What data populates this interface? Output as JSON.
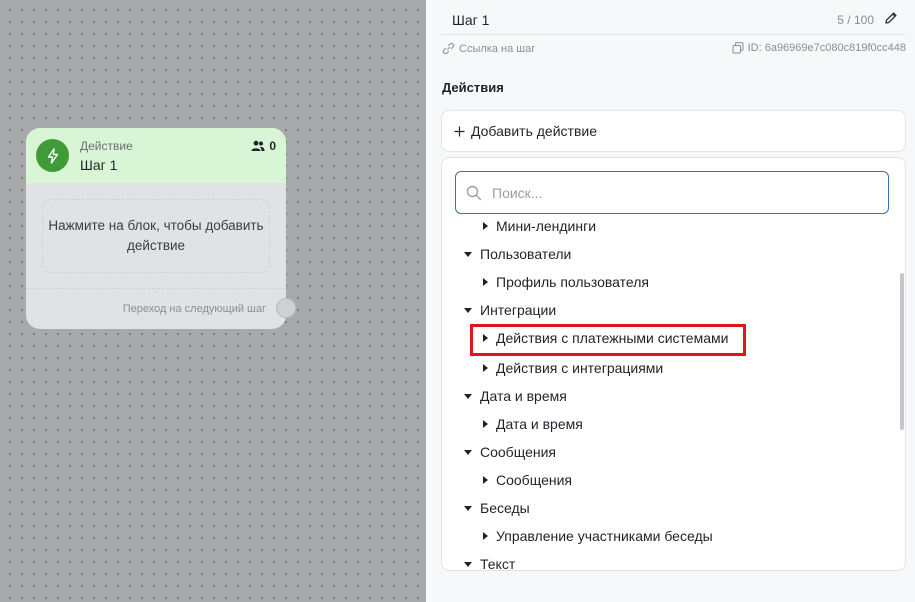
{
  "canvas": {
    "node": {
      "type_label": "Действие",
      "title": "Шаг 1",
      "users_count": "0",
      "body_text": "Нажмите на блок, чтобы добавить действие",
      "next_label": "Переход на следующий шаг",
      "icon": "lightning-icon",
      "accent": "#3e9b35"
    }
  },
  "panel": {
    "step_name": "Шаг 1",
    "step_count": "5 / 100",
    "link_label": "Ссылка на шаг",
    "step_id": "ID: 6a96969e7c080c819f0cc448",
    "section_title": "Действия",
    "add_action_label": "Добавить действие",
    "search_placeholder": "Поиск...",
    "tree": [
      {
        "label": "Мини-лендинги",
        "level": 1,
        "expanded": false
      },
      {
        "label": "Пользователи",
        "level": 0,
        "expanded": true
      },
      {
        "label": "Профиль пользователя",
        "level": 1,
        "expanded": false
      },
      {
        "label": "Интеграции",
        "level": 0,
        "expanded": true
      },
      {
        "label": "Действия с платежными системами",
        "level": 1,
        "expanded": false,
        "highlighted": true
      },
      {
        "label": "Действия с интеграциями",
        "level": 1,
        "expanded": false
      },
      {
        "label": "Дата и время",
        "level": 0,
        "expanded": true
      },
      {
        "label": "Дата и время",
        "level": 1,
        "expanded": false
      },
      {
        "label": "Сообщения",
        "level": 0,
        "expanded": true
      },
      {
        "label": "Сообщения",
        "level": 1,
        "expanded": false
      },
      {
        "label": "Беседы",
        "level": 0,
        "expanded": true
      },
      {
        "label": "Управление участниками беседы",
        "level": 1,
        "expanded": false
      },
      {
        "label": "Текст",
        "level": 0,
        "expanded": true
      }
    ],
    "highlight_color": "#e0151e",
    "search_border_color": "#3a6fb0"
  }
}
